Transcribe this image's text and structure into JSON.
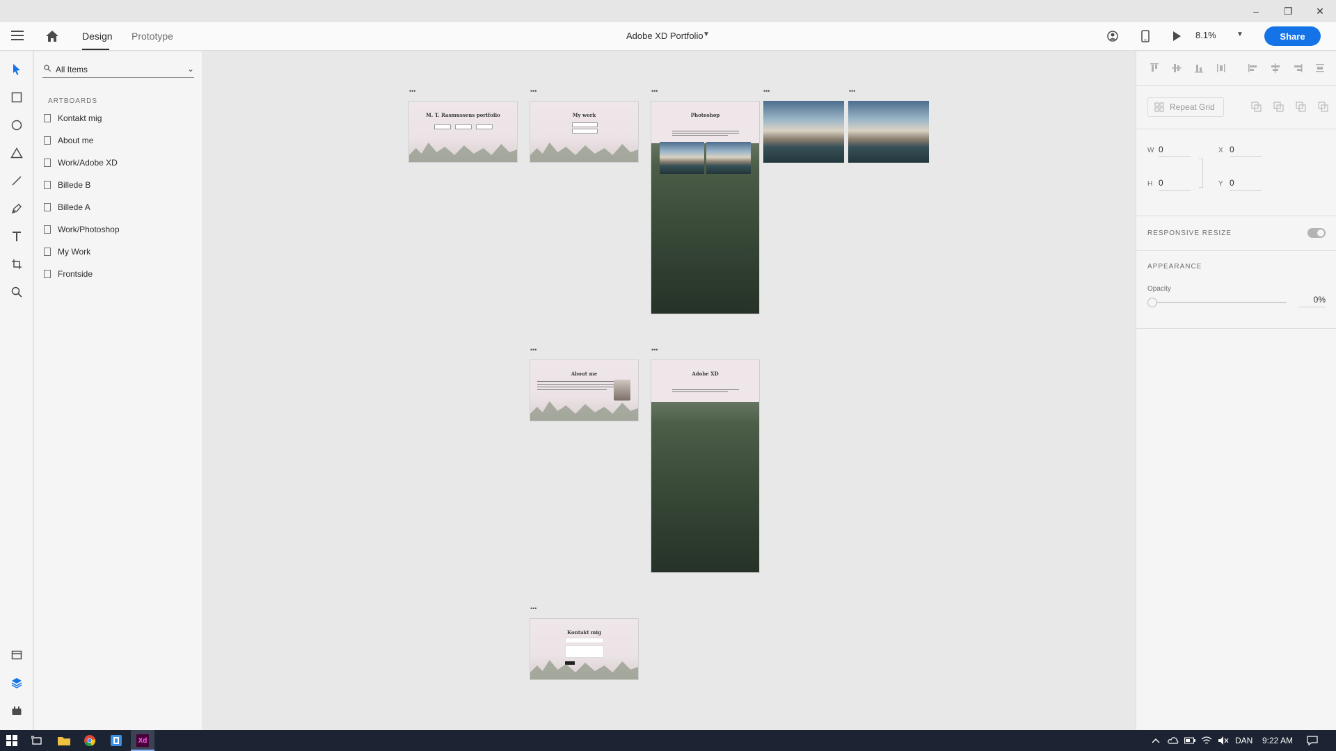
{
  "app": {
    "document_title": "Adobe XD Portfolio",
    "tabs": [
      {
        "label": "Design"
      },
      {
        "label": "Prototype"
      }
    ],
    "zoom": "8.1%",
    "share_label": "Share"
  },
  "window_controls": {
    "minimize": "–",
    "restore": "❐",
    "close": "✕"
  },
  "layers": {
    "filter_label": "All Items",
    "section_label": "ARTBOARDS",
    "artboards": [
      {
        "label": "Kontakt mig"
      },
      {
        "label": "About me"
      },
      {
        "label": "Work/Adobe XD"
      },
      {
        "label": "Billede B"
      },
      {
        "label": "Billede A"
      },
      {
        "label": "Work/Photoshop"
      },
      {
        "label": "My Work"
      },
      {
        "label": "Frontside"
      }
    ]
  },
  "canvas": {
    "artboard_marker": "•••",
    "frontside": {
      "title": "M. T. Rasmussens portfolio"
    },
    "mywork": {
      "title": "My work"
    },
    "photoshop": {
      "title": "Photoshop"
    },
    "aboutme": {
      "title": "About me"
    },
    "adobexd": {
      "title": "Adobe XD"
    },
    "kontakt": {
      "title": "Kontakt mig"
    }
  },
  "properties": {
    "repeat_grid_label": "Repeat Grid",
    "w_label": "W",
    "w_value": "0",
    "x_label": "X",
    "x_value": "0",
    "h_label": "H",
    "h_value": "0",
    "y_label": "Y",
    "y_value": "0",
    "responsive_resize_label": "RESPONSIVE RESIZE",
    "appearance_label": "APPEARANCE",
    "opacity_label": "Opacity",
    "opacity_value": "0%"
  },
  "taskbar": {
    "language": "DAN",
    "time": "9:22 AM"
  },
  "colors": {
    "accent": "#1473e6",
    "taskbar": "#1c2433",
    "xd_icon": "#470137"
  }
}
